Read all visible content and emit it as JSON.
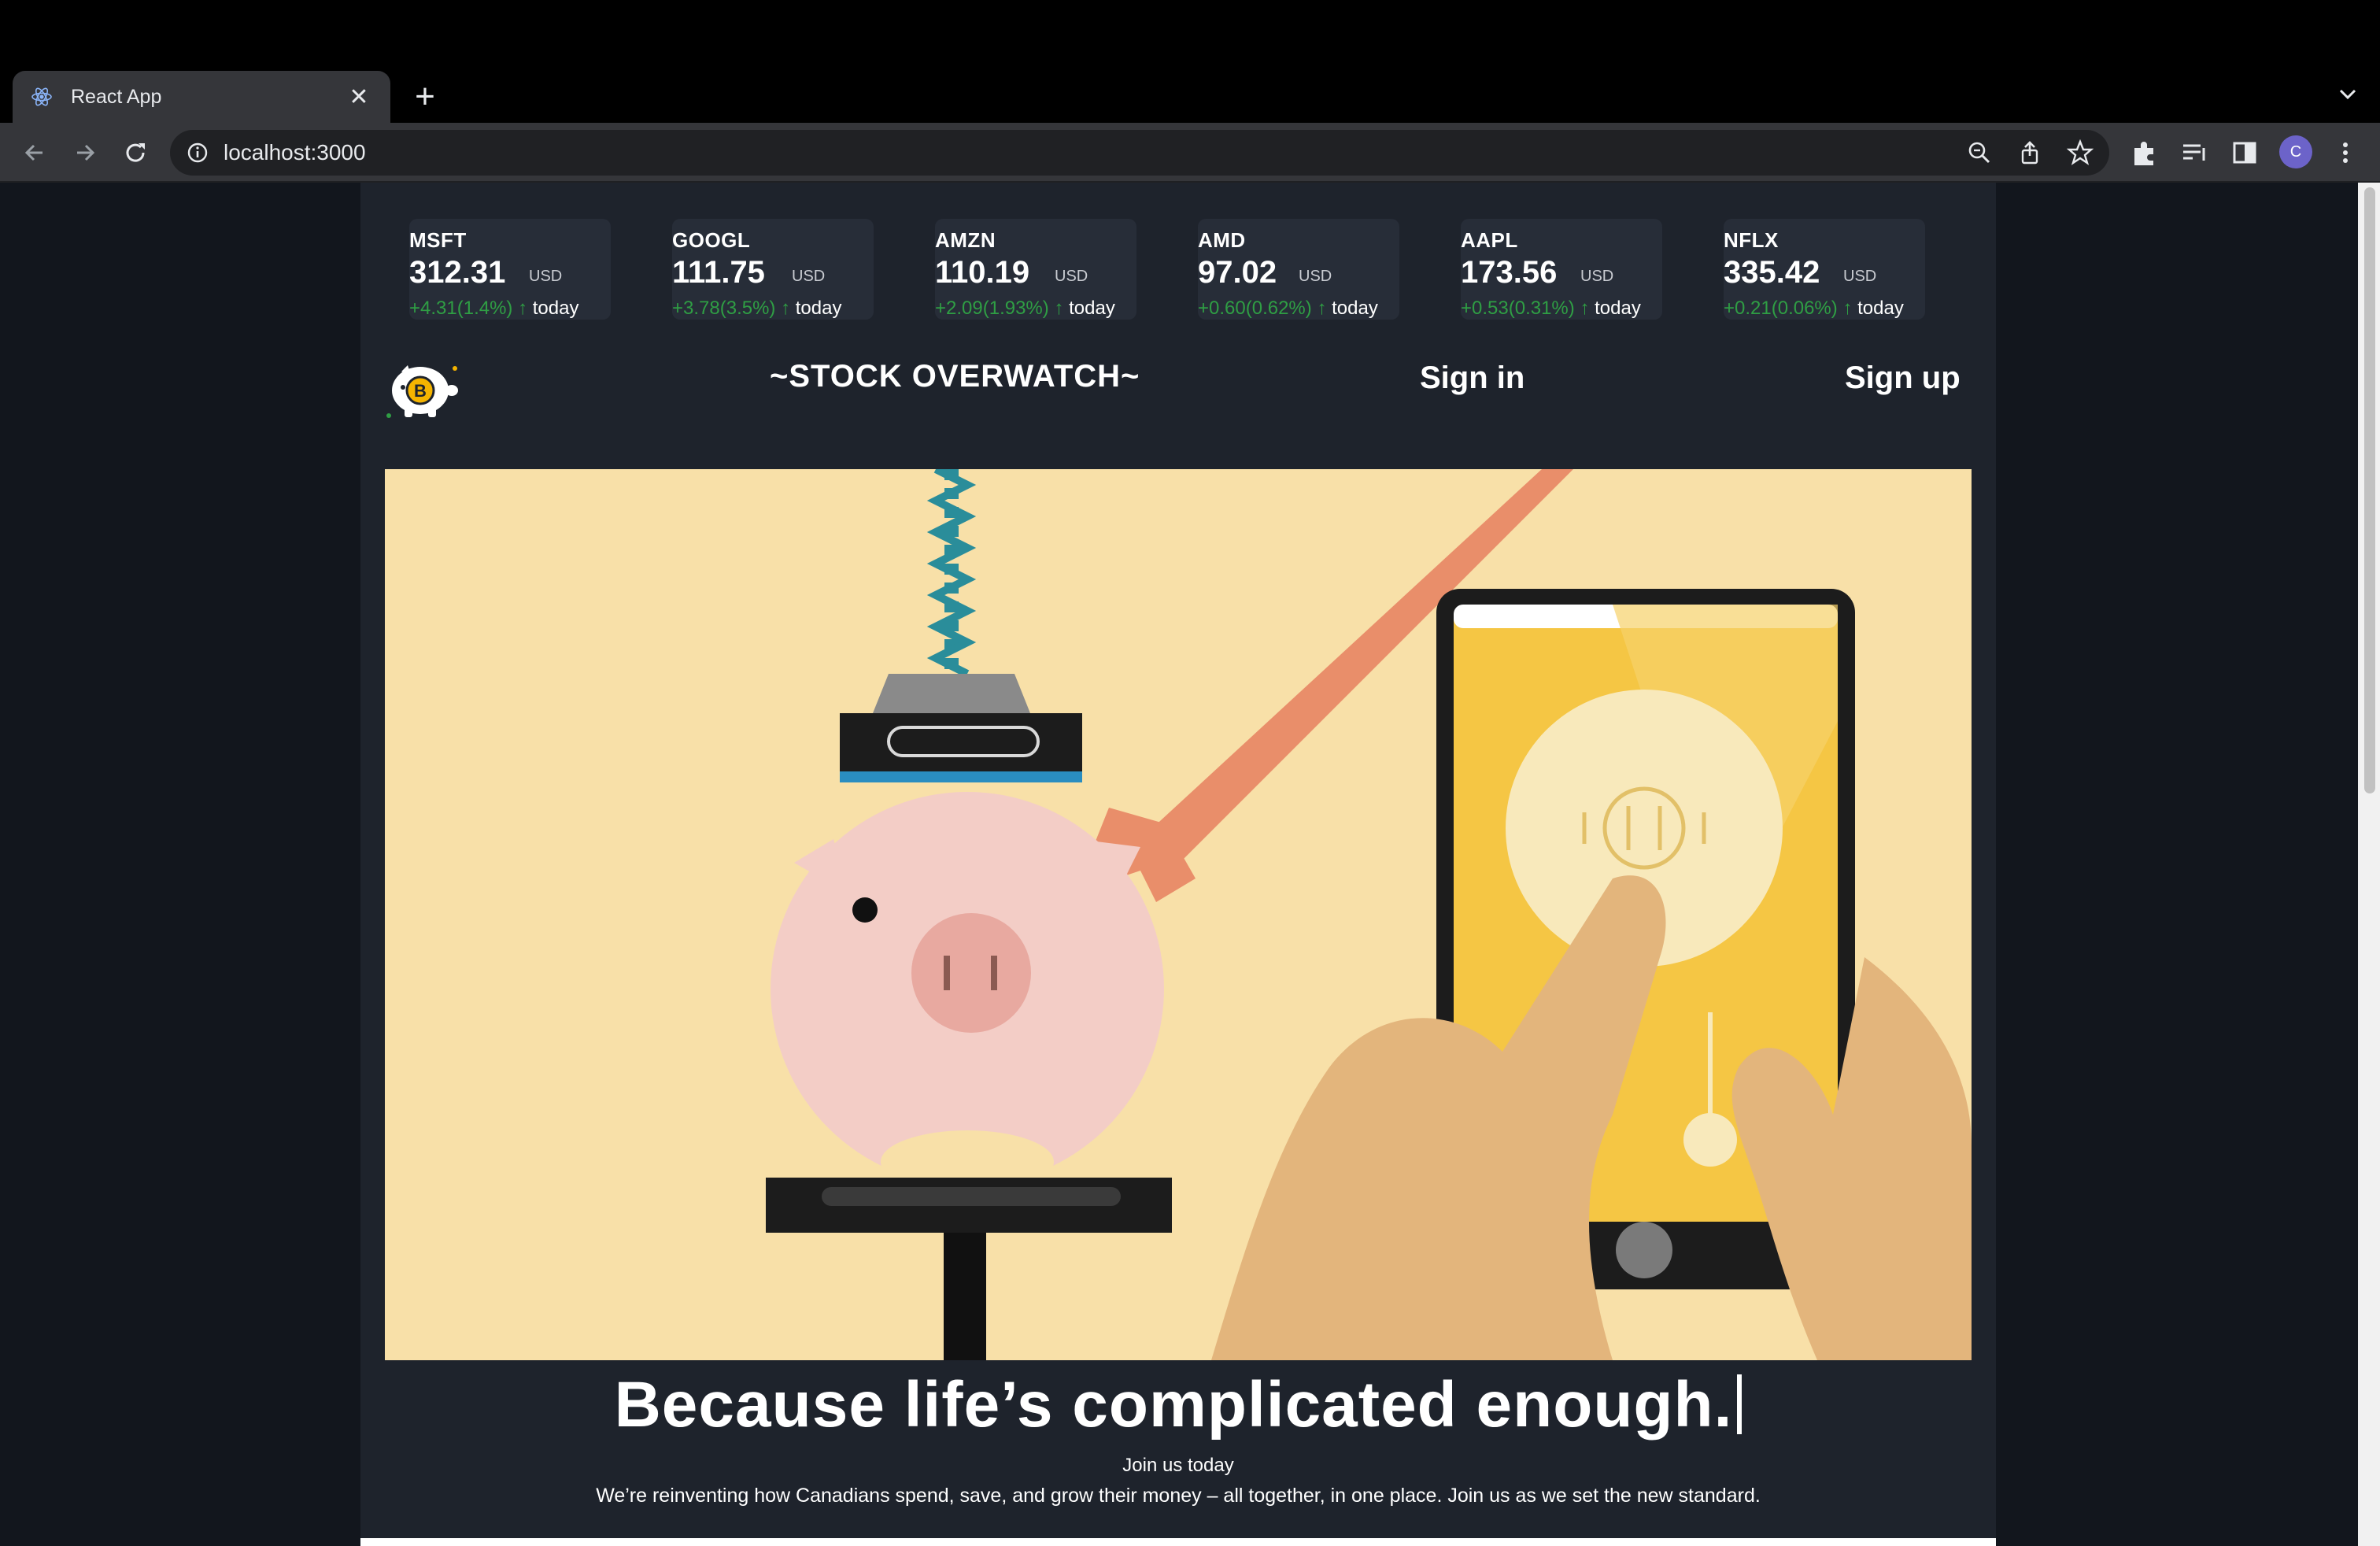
{
  "browser": {
    "tab_title": "React App",
    "url": "localhost:3000",
    "profile_initial": "C"
  },
  "tickers": [
    {
      "symbol": "MSFT",
      "price": "312.31",
      "currency": "USD",
      "change": "+4.31(1.4%)",
      "arrow": "↑",
      "period": "today"
    },
    {
      "symbol": "GOOGL",
      "price": "111.75",
      "currency": "USD",
      "change": "+3.78(3.5%)",
      "arrow": "↑",
      "period": "today"
    },
    {
      "symbol": "AMZN",
      "price": "110.19",
      "currency": "USD",
      "change": "+2.09(1.93%)",
      "arrow": "↑",
      "period": "today"
    },
    {
      "symbol": "AMD",
      "price": "97.02",
      "currency": "USD",
      "change": "+0.60(0.62%)",
      "arrow": "↑",
      "period": "today"
    },
    {
      "symbol": "AAPL",
      "price": "173.56",
      "currency": "USD",
      "change": "+0.53(0.31%)",
      "arrow": "↑",
      "period": "today"
    },
    {
      "symbol": "NFLX",
      "price": "335.42",
      "currency": "USD",
      "change": "+0.21(0.06%)",
      "arrow": "↑",
      "period": "today"
    }
  ],
  "header": {
    "brand": "~STOCK OVERWATCH~",
    "sign_in": "Sign in",
    "sign_up": "Sign up"
  },
  "hero": {
    "headline": "Because life’s complicated enough.",
    "join": "Join us today",
    "tagline": "We’re reinventing how Canadians spend, save, and grow their money – all together, in one place. Join us as we set the new standard."
  },
  "colors": {
    "page_bg": "#12161d",
    "app_bg": "#1e232c",
    "card_bg": "#272d38",
    "positive": "#2f9e44",
    "hero_bg": "#f8e0a8"
  },
  "icons": [
    "react-favicon",
    "close-icon",
    "plus-icon",
    "back-icon",
    "forward-icon",
    "reload-icon",
    "info-icon",
    "zoom-icon",
    "share-icon",
    "star-icon",
    "extensions-icon",
    "reading-list-icon",
    "side-panel-icon",
    "more-icon",
    "piggy-bitcoin-logo"
  ]
}
